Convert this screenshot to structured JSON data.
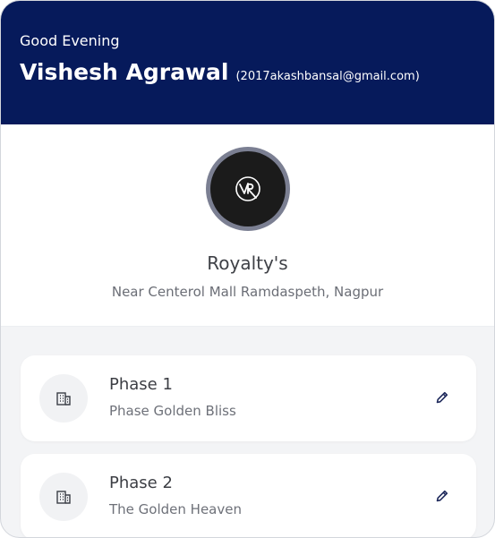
{
  "header": {
    "greeting": "Good Evening",
    "user_name": "Vishesh Agrawal",
    "user_email": "(2017akashbansal@gmail.com)"
  },
  "project": {
    "logo_icon": "vr-monogram-logo",
    "name": "Royalty's",
    "address": "Near Centerol Mall Ramdaspeth, Nagpur"
  },
  "phases": [
    {
      "title": "Phase 1",
      "subtitle": "Phase Golden Bliss",
      "icon": "building-icon",
      "action_icon": "pencil-icon"
    },
    {
      "title": "Phase 2",
      "subtitle": "The Golden Heaven",
      "icon": "building-icon",
      "action_icon": "pencil-icon"
    }
  ],
  "colors": {
    "header_bg": "#061a5b",
    "accent_icon": "#1f2a5c",
    "page_bg": "#f3f4f6",
    "card_bg": "#ffffff"
  }
}
